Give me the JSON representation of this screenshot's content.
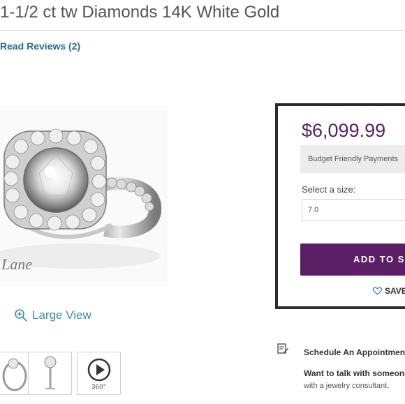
{
  "product": {
    "title": "1-1/2 ct tw Diamonds 14K White Gold",
    "reviews_link": "Read Reviews (2)",
    "watermark": "Lane"
  },
  "gallery": {
    "large_view_label": "Large View",
    "thumb_360_label": "360°"
  },
  "buybox": {
    "price": "$6,099.99",
    "budget_label": "Budget Friendly Payments",
    "size_label": "Select a size:",
    "size_value": "7.0",
    "add_button": "ADD TO S",
    "save_label": "SAVE"
  },
  "appointment": {
    "title": "Schedule An Appointment",
    "line1": "Want to talk with someone",
    "line2": "with a jewelry consultant."
  },
  "colors": {
    "brand_purple": "#5b1f65",
    "link_blue": "#2b6c8f",
    "teal": "#3a8da8"
  }
}
